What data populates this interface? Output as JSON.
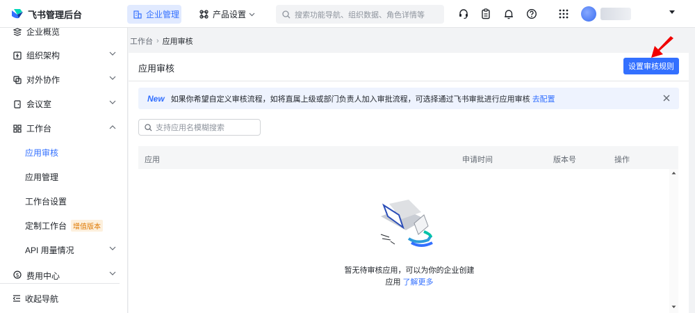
{
  "app": {
    "title": "飞书管理后台"
  },
  "topnav": {
    "enterprise_label": "企业管理",
    "product_label": "产品设置",
    "search_placeholder": "搜索功能导航、组织数据、角色详情等"
  },
  "sidebar": {
    "items": [
      {
        "label": "企业概览",
        "icon": "overview-icon"
      },
      {
        "label": "组织架构",
        "icon": "org-icon"
      },
      {
        "label": "对外协作",
        "icon": "collab-icon"
      },
      {
        "label": "会议室",
        "icon": "meeting-room-icon"
      },
      {
        "label": "工作台",
        "icon": "workbench-icon"
      },
      {
        "label": "费用中心",
        "icon": "billing-icon"
      }
    ],
    "subitems": [
      {
        "label": "应用审核"
      },
      {
        "label": "应用管理"
      },
      {
        "label": "工作台设置"
      },
      {
        "label": "定制工作台",
        "badge": "增值版本"
      },
      {
        "label": "API 用量情况"
      }
    ],
    "collapse_label": "收起导航"
  },
  "breadcrumb": {
    "parent": "工作台",
    "current": "应用审核"
  },
  "page": {
    "title": "应用审核",
    "rule_button": "设置审核规则",
    "notice": {
      "tag": "New",
      "text": "如果你希望自定义审核流程，如将直属上级或部门负责人加入审批流程，可选择通过飞书审批进行应用审核",
      "link": "去配置"
    },
    "app_search_placeholder": "支持应用名模糊搜索",
    "table": {
      "columns": [
        "应用",
        "申请时间",
        "版本号",
        "操作"
      ]
    },
    "empty": {
      "line1": "暂无待审核应用，可以为你的企业创建",
      "line2_prefix": "应用",
      "line2_link": "了解更多"
    }
  },
  "colors": {
    "accent": "#3370ff",
    "badge": "#de7802",
    "arrow": "#f00000"
  }
}
